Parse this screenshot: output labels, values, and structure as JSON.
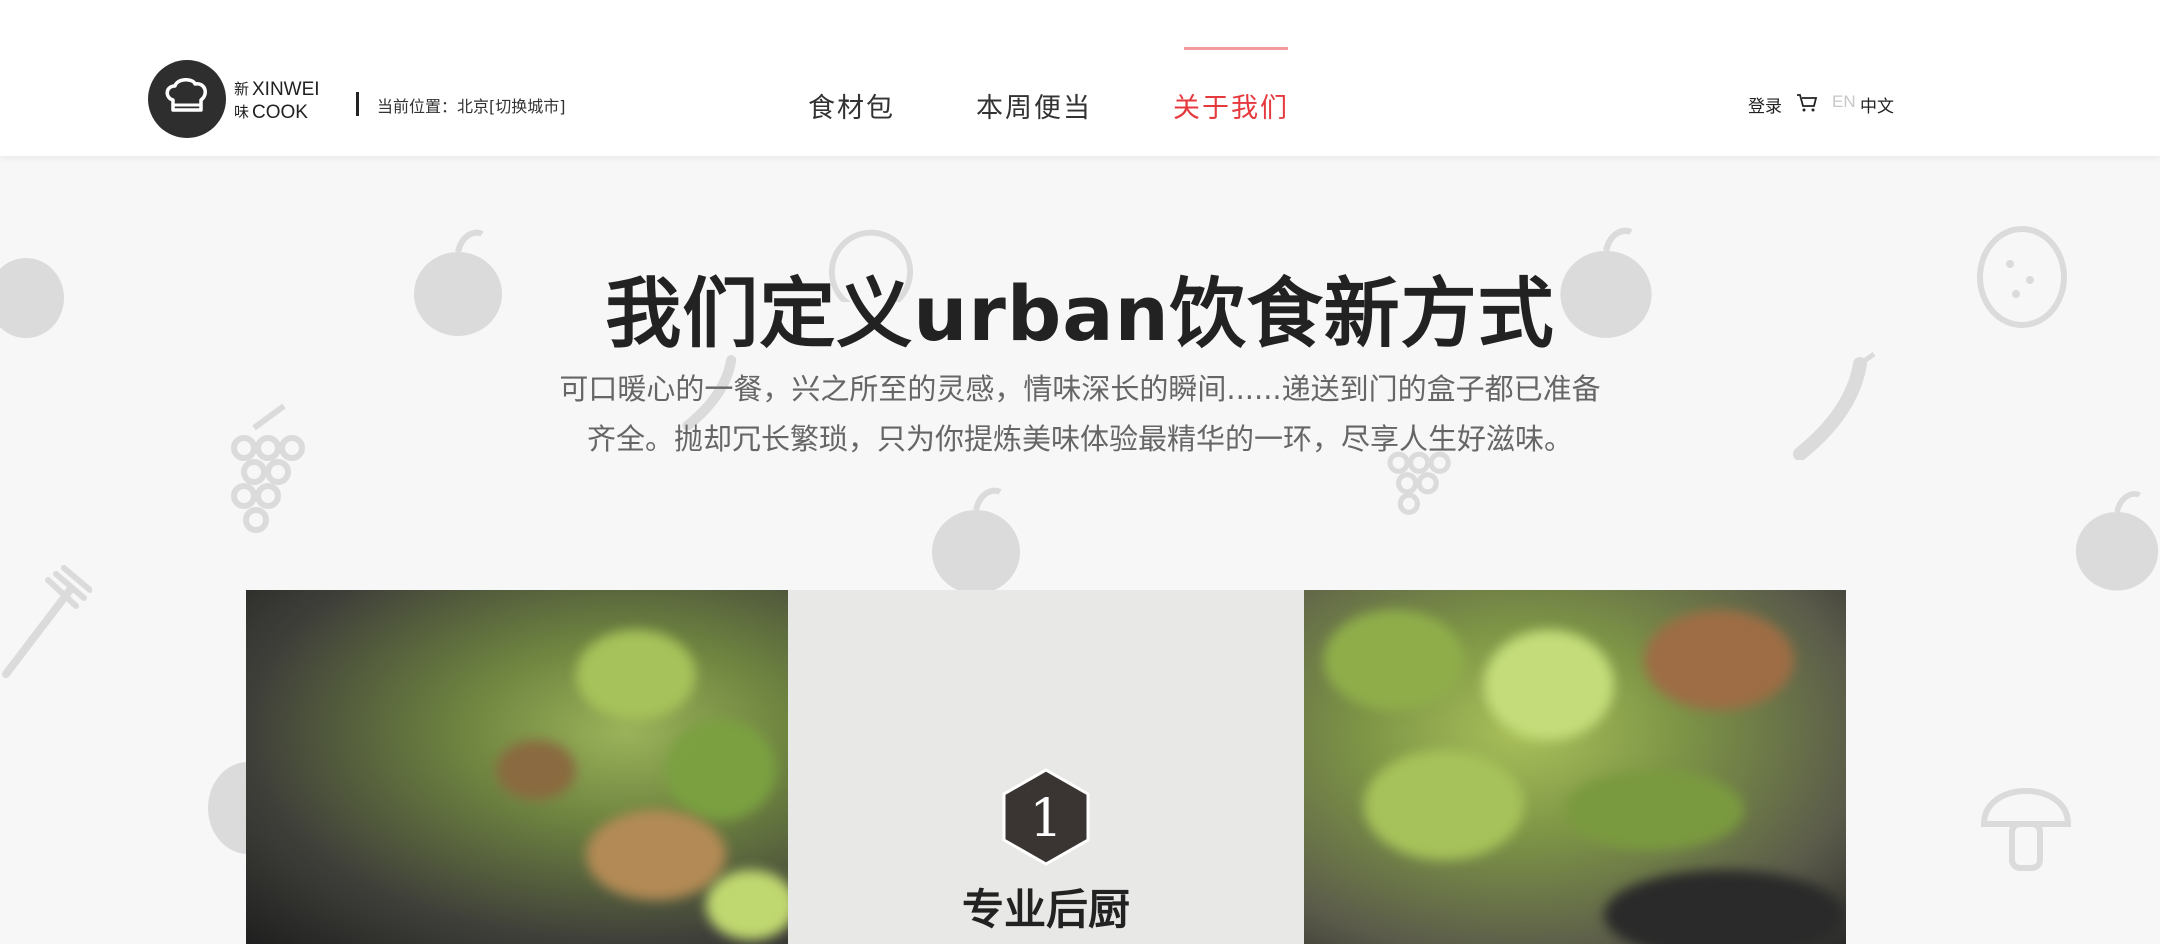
{
  "header": {
    "logo": {
      "cn_top": "新",
      "cn_bottom": "味",
      "en_top": "XINWEI",
      "en_bottom": "COOK"
    },
    "location": "当前位置：北京[切换城市]",
    "nav": [
      {
        "label": "食材包",
        "active": false
      },
      {
        "label": "本周便当",
        "active": false
      },
      {
        "label": "关于我们",
        "active": true
      }
    ],
    "login": "登录",
    "lang_en": "EN",
    "lang_cn": "中文",
    "accent_color": "#e6393e"
  },
  "hero": {
    "title": "我们定义urban饮食新方式",
    "desc_line1": "可口暖心的一餐，兴之所至的灵感，情味深长的瞬间......递送到门的盒子都已准备",
    "desc_line2": "齐全。抛却冗长繁琐，只为你提炼美味体验最精华的一环，尽享人生好滋味。"
  },
  "feature": {
    "number": "1",
    "title": "专业后厨"
  },
  "icons": [
    "chef-hat-icon",
    "cart-icon",
    "fruit-icon",
    "grapes-icon",
    "chili-icon",
    "fork-icon",
    "mushroom-icon"
  ]
}
